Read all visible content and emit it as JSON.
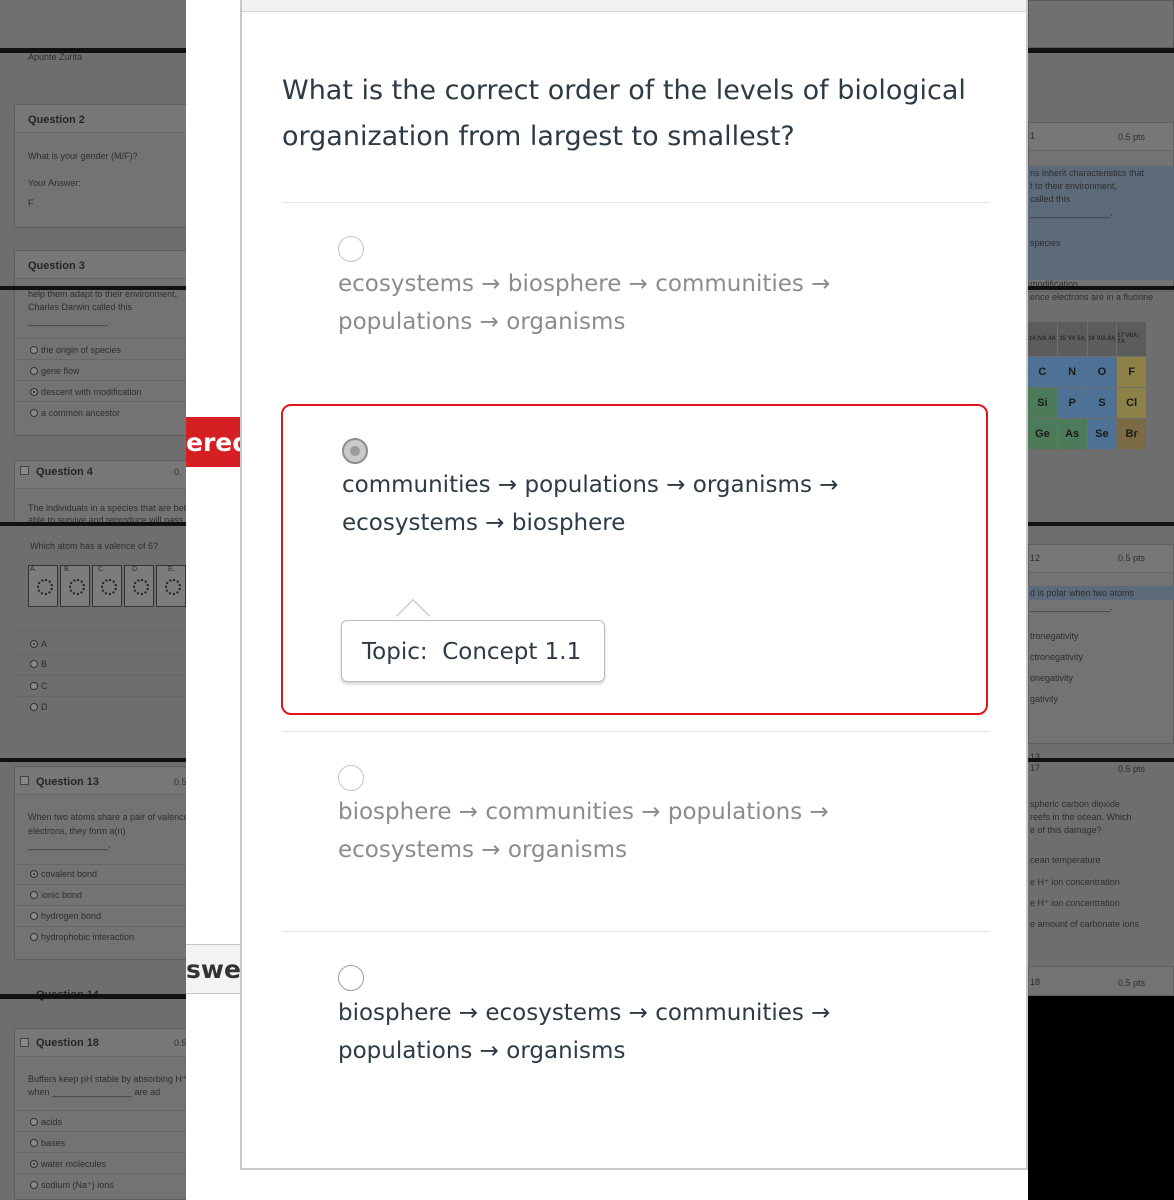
{
  "dialog": {
    "question": "What is the correct order of the levels of biological organization from largest to smallest?",
    "answers": [
      {
        "line1": "ecosystems → biosphere → communities →",
        "line2": "populations → organisms",
        "selected": false,
        "faded": true
      },
      {
        "line1": "communities → populations → organisms →",
        "line2": "ecosystems → biosphere",
        "selected": true,
        "faded": false
      },
      {
        "line1": "biosphere → communities → populations →",
        "line2": "ecosystems → organisms",
        "selected": false,
        "faded": true
      },
      {
        "line1": "biosphere → ecosystems → communities →",
        "line2": "populations → organisms",
        "selected": false,
        "faded": false
      }
    ],
    "tooltip": "Topic:  Concept 1.1",
    "flag_wrong_label": "ered",
    "flag_correct_label": "swer",
    "colors": {
      "wrong": "#d51f23",
      "text": "#2d3b45",
      "faded_text": "#8c8c8c"
    }
  },
  "background_left": {
    "name_fragment": "Apunte Zurita",
    "q2": {
      "title": "Question 2",
      "prompt": "What is your gender (M/F)?",
      "your_answer_label": "Your Answer:",
      "value": "F"
    },
    "q3": {
      "title": "Question 3",
      "prompt_line1": "help them adapt to their environment,",
      "prompt_line2": "Charles Darwin called this",
      "blank": "________________.",
      "options": [
        "the origin of species",
        "gene flow",
        "descent with modification",
        "a common ancestor"
      ]
    },
    "q4": {
      "title": "Question 4",
      "points_fragment": "0.",
      "prompt_line1": "The individuals in a species that are bette",
      "prompt_line2": "able to survive and reproduce will pass o"
    },
    "valence": {
      "prompt": "Which atom has a valence of 6?",
      "image_labels": [
        "A.",
        "B.",
        "C.",
        "D.",
        "E."
      ],
      "options": [
        "A",
        "B",
        "C",
        "D"
      ]
    },
    "q13": {
      "title": "Question 13",
      "points_fragment": "0.5",
      "prompt_line1": "When two atoms share a pair of valence",
      "prompt_line2": "electrons, they form a(n)",
      "blank": "________________.",
      "options": [
        "covalent bond",
        "ionic bond",
        "hydrogen bond",
        "hydrophobic interaction"
      ]
    },
    "q14_fragment": "Question 14",
    "q18": {
      "title": "Question 18",
      "points_fragment": "0.5",
      "prompt_line1": "Buffers keep pH stable by absorbing H⁺ i",
      "prompt_line2": "when ________________ are ad",
      "options": [
        "acids",
        "bases",
        "water molecules",
        "sodium (Na⁺) ions"
      ]
    }
  },
  "background_right": {
    "q_fragment_top": "1",
    "pts": "0.5 pts",
    "darwin_lines": [
      "ns inherit characteristics that",
      "t to their environment,",
      "called this",
      "________________."
    ],
    "species_fragment": "species",
    "modification_fragment": "modification",
    "fluorine_fragment": "ence electrons are in a fluorine",
    "ptable": {
      "heads": [
        "14 IVA 4A",
        "15 VA 5A",
        "16 VIA 6A",
        "17 VIIA 7A"
      ],
      "rows": [
        [
          "C",
          "N",
          "O",
          "F"
        ],
        [
          "Si",
          "P",
          "S",
          "Cl"
        ],
        [
          "Ge",
          "As",
          "Se",
          "Br"
        ]
      ]
    },
    "q12": {
      "number": "12",
      "pts": "0.5 pts",
      "prompt": "d is polar when two atoms",
      "blank": "________________.",
      "options": [
        "tronegativity",
        "ctronegativity",
        "onegativity",
        "gativity"
      ]
    },
    "q13_fragment": "13",
    "q17": {
      "number": "17",
      "pts": "0.5 pts",
      "lines": [
        "spheric carbon dioxide",
        "reefs in the ocean. Which",
        "e of this damage?"
      ],
      "options": [
        "cean temperature",
        "e H⁺ ion concentration",
        "e H⁺ ion concentration",
        "e amount of carbonate ions"
      ]
    },
    "q18": {
      "number": "18",
      "pts": "0.5 pts"
    }
  }
}
